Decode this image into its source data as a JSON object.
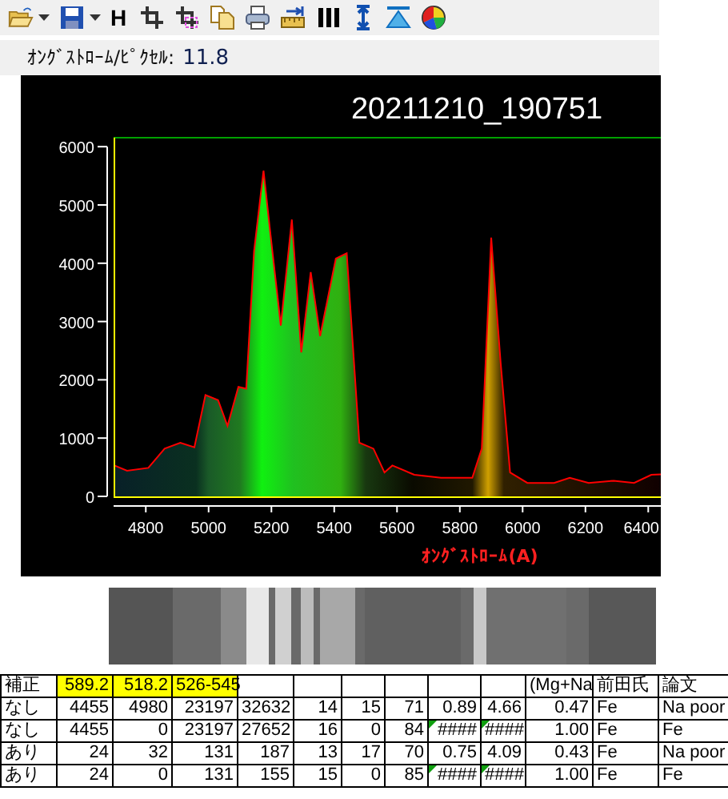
{
  "toolbar": [
    {
      "kind": "folder"
    },
    {
      "kind": "caret"
    },
    {
      "kind": "floppy"
    },
    {
      "kind": "caret"
    },
    {
      "kind": "text",
      "label": "H"
    },
    {
      "kind": "crop"
    },
    {
      "kind": "crop-select"
    },
    {
      "kind": "copy"
    },
    {
      "kind": "printer"
    },
    {
      "kind": "ruler"
    },
    {
      "kind": "bars"
    },
    {
      "kind": "vresize"
    },
    {
      "kind": "triangle"
    },
    {
      "kind": "ball"
    }
  ],
  "scale": {
    "label": "ｵﾝｸﾞｽﾄﾛｰﾑ/ﾋﾟｸｾﾙ:",
    "value": "11.8"
  },
  "spectrum": {
    "title": "20211210_190751",
    "chart_data": {
      "type": "area",
      "xlabel": "ｵﾝｸﾞｽﾄﾛｰﾑ(A)",
      "xlim": [
        4700,
        6440
      ],
      "ylim": [
        0,
        6000
      ],
      "xticks": [
        4800,
        5000,
        5200,
        5400,
        5600,
        5800,
        6000,
        6200,
        6400
      ],
      "yticks": [
        0,
        1000,
        2000,
        3000,
        4000,
        5000,
        6000
      ],
      "x": [
        4700,
        4740,
        4808,
        4860,
        4910,
        4955,
        4990,
        5030,
        5060,
        5095,
        5120,
        5145,
        5175,
        5195,
        5230,
        5265,
        5295,
        5325,
        5355,
        5405,
        5440,
        5480,
        5525,
        5560,
        5585,
        5655,
        5740,
        5840,
        5870,
        5900,
        5930,
        5960,
        6015,
        6100,
        6150,
        6210,
        6290,
        6355,
        6410,
        6440
      ],
      "series": [
        {
          "color": "#ff0000",
          "values": [
            530,
            440,
            490,
            820,
            920,
            840,
            1740,
            1650,
            1210,
            1880,
            1850,
            4210,
            5590,
            4580,
            2930,
            4750,
            2470,
            3850,
            2750,
            4080,
            4170,
            920,
            820,
            410,
            530,
            370,
            320,
            320,
            820,
            4440,
            2290,
            410,
            230,
            230,
            320,
            230,
            270,
            230,
            370,
            380
          ]
        }
      ]
    }
  },
  "table": {
    "header": [
      {
        "text": "補正",
        "highlight": false
      },
      {
        "text": "589.2",
        "highlight": true
      },
      {
        "text": "518.2",
        "highlight": true
      },
      {
        "text": "526-545",
        "highlight": true
      },
      {
        "highlight": false
      },
      {
        "highlight": false
      },
      {
        "highlight": false
      },
      {
        "highlight": false
      },
      {
        "highlight": false
      },
      {
        "highlight": false
      },
      {
        "text": "(Mg+Na",
        "highlight": false
      },
      {
        "text": "前田氏",
        "highlight": false
      },
      {
        "text": "論文",
        "highlight": false
      }
    ],
    "rows": [
      [
        "なし",
        "4455",
        "4980",
        "23197",
        "32632",
        "14",
        "15",
        "71",
        "0.89",
        "4.66",
        "0.47",
        "Fe",
        "Na poor"
      ],
      [
        "なし",
        "4455",
        "0",
        "23197",
        "27652",
        "16",
        "0",
        "84",
        {
          "text": "####",
          "flagged": true
        },
        {
          "text": "####",
          "flagged": true
        },
        "1.00",
        "Fe",
        "Fe"
      ],
      [
        "あり",
        "24",
        "32",
        "131",
        "187",
        "13",
        "17",
        "70",
        "0.75",
        "4.09",
        "0.43",
        "Fe",
        "Na poor"
      ],
      [
        "あり",
        "24",
        "0",
        "131",
        "155",
        "15",
        "0",
        "85",
        {
          "text": "####",
          "flagged": true
        },
        {
          "text": "####",
          "flagged": true
        },
        "1.00",
        "Fe",
        "Fe"
      ]
    ]
  }
}
